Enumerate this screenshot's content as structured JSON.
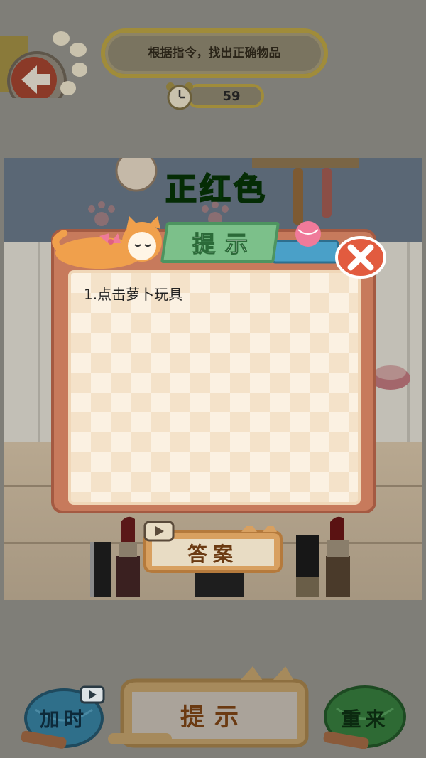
{
  "header": {
    "instruction": "根据指令，找出正确物品",
    "timer_value": "59"
  },
  "scene": {
    "target_word": "正红色"
  },
  "hint_dialog": {
    "title": "提示",
    "hint_lines": [
      "1.点击萝卜玩具"
    ]
  },
  "answer_button": {
    "label": "答案"
  },
  "bottom_bar": {
    "add_time_label": "加时",
    "hint_label": "提示",
    "restart_label": "重来"
  },
  "colors": {
    "target_word": "#0b8a10",
    "hint_tab": "#7cc08a",
    "dialog_frame": "#c77a5c",
    "add_time_button": "#2f8ab0",
    "restart_button": "#3a9a3f",
    "close_button": "#e25b3f"
  },
  "icons": {
    "back": "paw-back-arrow-icon",
    "timer": "alarm-clock-icon",
    "close": "close-icon",
    "video": "video-ad-icon"
  }
}
